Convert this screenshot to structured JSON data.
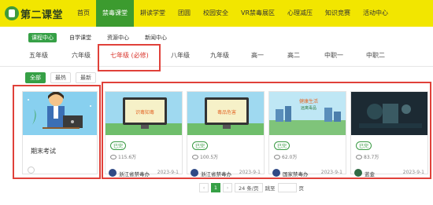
{
  "header": {
    "logo_text": "第二课堂",
    "nav": [
      "首页",
      "禁毒课堂",
      "耕读学堂",
      "团圆",
      "校园安全",
      "VR禁毒展区",
      "心理减压",
      "知识竞赛",
      "活动中心"
    ],
    "active_nav": "禁毒课堂"
  },
  "subtabs": [
    "课程中心",
    "自学课堂",
    "资源中心",
    "新闻中心"
  ],
  "grades": [
    "五年级",
    "六年级",
    "七年级 (必修)",
    "八年级",
    "九年级",
    "高一",
    "高二",
    "中职一",
    "中职二"
  ],
  "filters": [
    "全部",
    "最热",
    "最新"
  ],
  "exam_card": {
    "title": "期末考试"
  },
  "cards": [
    {
      "status": "已完",
      "views": "115.6万",
      "author": "浙江省禁毒办",
      "date": "2023-9-1",
      "thumb_text": "识毒知毒 牢记禁毒口诀"
    },
    {
      "status": "已完",
      "views": "100.5万",
      "author": "浙江省禁毒办",
      "date": "2023-9-1",
      "thumb_text": "毒品危害 共同守护"
    },
    {
      "status": "已完",
      "views": "62.0万",
      "author": "国家禁毒办",
      "date": "2023-9-1",
      "thumb_text": "健康生活 远离毒品"
    },
    {
      "status": "已完",
      "views": "83.7万",
      "author": "蓝金",
      "date": "2023-9-1",
      "thumb_text": ""
    }
  ],
  "pager": {
    "prev": "‹",
    "current": "1",
    "next": "›",
    "page_size": "24 条/页",
    "jump_label": "跳至",
    "page_suffix": "页"
  },
  "colors": {
    "brand_yellow": "#f2e600",
    "brand_green": "#36a046",
    "highlight_red": "#e0413a"
  }
}
